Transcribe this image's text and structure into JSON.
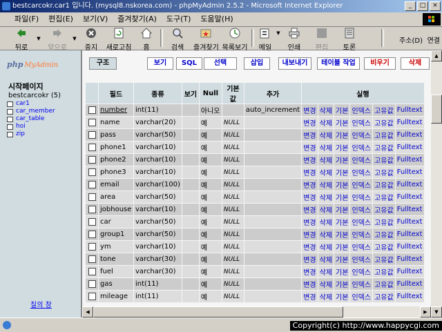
{
  "window": {
    "title": "bestcarcokr.car1 입니다. (mysql8.nskorea.com) - phpMyAdmin 2.5.2 - Microsoft Internet Explorer",
    "buttons": {
      "minimize": "_",
      "maximize": "□",
      "close": "×"
    }
  },
  "menubar": {
    "items": [
      "파일(F)",
      "편집(E)",
      "보기(V)",
      "즐겨찾기(A)",
      "도구(T)",
      "도움말(H)"
    ]
  },
  "toolbar": {
    "back": "뒤로",
    "forward": "앞으로",
    "stop": "중지",
    "refresh": "새로고침",
    "home": "홈",
    "search": "검색",
    "favorites": "즐겨찾기",
    "history": "목록보기",
    "mail": "메일",
    "print": "인쇄",
    "edit": "편집",
    "discuss": "토론",
    "address_label": "주소(D)",
    "links_label": "연결"
  },
  "left_frame": {
    "logo_php": "php",
    "logo_admin": "MyAdmin",
    "home_link": "시작페이지",
    "database": "bestcarcokr",
    "table_count": "(5)",
    "tables": [
      "car1",
      "car_member",
      "car_table",
      "hoi",
      "zip"
    ],
    "query_window": "질의 창"
  },
  "tabs": [
    {
      "label": "구조",
      "active": true
    },
    {
      "label": "보기"
    },
    {
      "label": "SQL"
    },
    {
      "label": "선택"
    },
    {
      "label": "삽입"
    },
    {
      "label": "내보내기"
    },
    {
      "label": "테이블 작업"
    },
    {
      "label": "비우기",
      "danger": true
    },
    {
      "label": "삭제",
      "danger": true
    }
  ],
  "table": {
    "headers": {
      "field": "필드",
      "type": "종류",
      "attributes": "보기",
      "null": "Null",
      "default": "기본값",
      "extra": "추가",
      "action": "실행"
    },
    "actions": [
      "변경",
      "삭제",
      "기본",
      "인덱스",
      "고유값",
      "Fulltext"
    ],
    "rows": [
      {
        "field": "number",
        "type": "int(11)",
        "null": "아니오",
        "default": "",
        "extra": "auto_increment"
      },
      {
        "field": "name",
        "type": "varchar(20)",
        "null": "예",
        "default": "NULL",
        "extra": ""
      },
      {
        "field": "pass",
        "type": "varchar(50)",
        "null": "예",
        "default": "NULL",
        "extra": ""
      },
      {
        "field": "phone1",
        "type": "varchar(10)",
        "null": "예",
        "default": "NULL",
        "extra": ""
      },
      {
        "field": "phone2",
        "type": "varchar(10)",
        "null": "예",
        "default": "NULL",
        "extra": ""
      },
      {
        "field": "phone3",
        "type": "varchar(10)",
        "null": "예",
        "default": "NULL",
        "extra": ""
      },
      {
        "field": "email",
        "type": "varchar(100)",
        "null": "예",
        "default": "NULL",
        "extra": ""
      },
      {
        "field": "area",
        "type": "varchar(50)",
        "null": "예",
        "default": "NULL",
        "extra": ""
      },
      {
        "field": "jobhouse",
        "type": "varchar(10)",
        "null": "예",
        "default": "NULL",
        "extra": ""
      },
      {
        "field": "car",
        "type": "varchar(50)",
        "null": "예",
        "default": "NULL",
        "extra": ""
      },
      {
        "field": "group1",
        "type": "varchar(50)",
        "null": "예",
        "default": "NULL",
        "extra": ""
      },
      {
        "field": "ym",
        "type": "varchar(10)",
        "null": "예",
        "default": "NULL",
        "extra": ""
      },
      {
        "field": "tone",
        "type": "varchar(30)",
        "null": "예",
        "default": "NULL",
        "extra": ""
      },
      {
        "field": "fuel",
        "type": "varchar(30)",
        "null": "예",
        "default": "NULL",
        "extra": ""
      },
      {
        "field": "gas",
        "type": "int(11)",
        "null": "예",
        "default": "NULL",
        "extra": ""
      },
      {
        "field": "mileage",
        "type": "int(11)",
        "null": "예",
        "default": "NULL",
        "extra": ""
      }
    ]
  },
  "status_bar": {
    "copyright": "Copyright(c) http://www.happycgi.com"
  }
}
